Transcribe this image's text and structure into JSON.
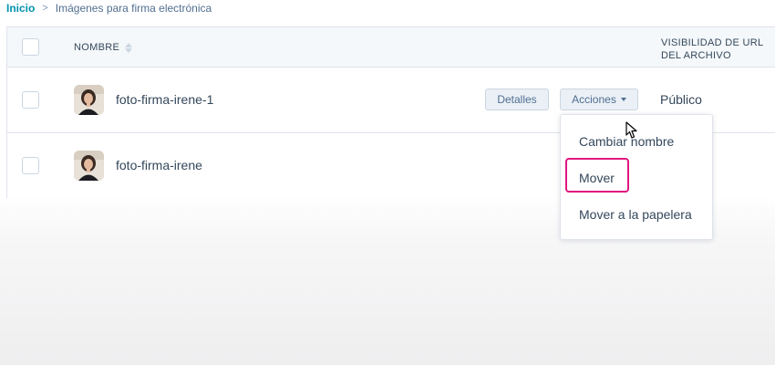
{
  "breadcrumb": {
    "home": "Inicio",
    "separator": ">",
    "current": "Imágenes para firma electrónica"
  },
  "table": {
    "columns": {
      "name": "NOMBRE",
      "visibility": "VISIBILIDAD DE URL DEL ARCHIVO"
    },
    "rows": [
      {
        "filename": "foto-firma-irene-1",
        "details_label": "Detalles",
        "actions_label": "Acciones",
        "visibility": "Público"
      },
      {
        "filename": "foto-firma-irene"
      }
    ]
  },
  "actions_menu": {
    "items": [
      "Cambiar nombre",
      "Mover",
      "Mover a la papelera"
    ],
    "highlighted": "Mover"
  },
  "colors": {
    "link": "#0091ae",
    "text": "#33475b",
    "border": "#dfe3eb",
    "highlight": "#e0177f"
  },
  "icons": [
    "chevron-right-icon",
    "sort-icon",
    "caret-down-icon",
    "mouse-cursor-icon"
  ]
}
